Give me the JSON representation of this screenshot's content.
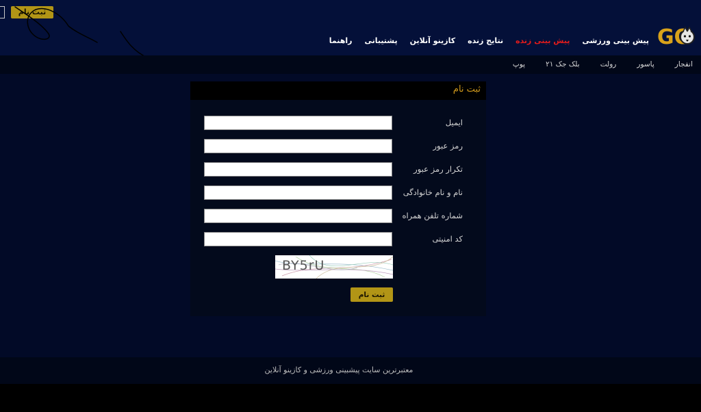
{
  "header": {
    "register_button": "ثبت نام",
    "logo_text": "GO",
    "nav": [
      {
        "label": "پیش بینی ورزشی"
      },
      {
        "label": "پیش بینی زنده"
      },
      {
        "label": "نتایج زنده"
      },
      {
        "label": "کازینو آنلاین"
      },
      {
        "label": "پشتیبانی"
      },
      {
        "label": "راهنما"
      }
    ]
  },
  "subnav": [
    {
      "label": "انفجار"
    },
    {
      "label": "پاسور"
    },
    {
      "label": "رولت"
    },
    {
      "label": "بلک جک ۲۱"
    },
    {
      "label": "پوپ"
    }
  ],
  "form": {
    "title": "ثبت نام",
    "fields": [
      {
        "label": "ایمیل",
        "value": ""
      },
      {
        "label": "رمز عبور",
        "value": ""
      },
      {
        "label": "تکرار رمز عبور",
        "value": ""
      },
      {
        "label": "نام و نام خانوادگی",
        "value": ""
      },
      {
        "label": "شماره تلفن همراه",
        "value": ""
      },
      {
        "label": "کد امنیتی",
        "value": ""
      }
    ],
    "captcha_text": "BY5rU",
    "submit_label": "ثبت نام"
  },
  "footer": {
    "text": "معتبرترین سایت پیشبینی ورزشی و کازینو آنلاین"
  },
  "colors": {
    "background": "#020a27",
    "accent_gold": "#b29516",
    "title_orange": "#d19a1c",
    "live_red": "#e31b1b"
  }
}
